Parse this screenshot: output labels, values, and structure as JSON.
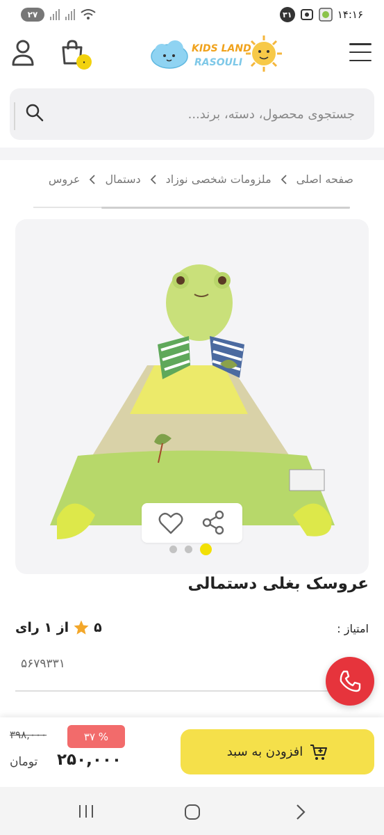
{
  "status_bar": {
    "time": "۱۴:۱۶",
    "notification_count": "۳۱",
    "battery": "۲۷"
  },
  "header": {
    "logo_line1": "KIDS LAND",
    "logo_line2": "RASOULI",
    "cart_count": "۰"
  },
  "search": {
    "placeholder": "جستجوی محصول، دسته، برند..."
  },
  "breadcrumb": [
    "صفحه اصلی",
    "ملزومات شخصی نوزاد",
    "دستمال",
    "عروس"
  ],
  "product": {
    "title": "عروسک بغلی دستمالی",
    "rating_label": "امتیاز :",
    "rating_score": "۵",
    "rating_suffix": "از ۱ رای",
    "sku": "۵۶۷۹۳۳۱"
  },
  "gallery": {
    "dots": 3,
    "active_dot": 0
  },
  "purchase": {
    "add_to_cart": "افزودن به سبد",
    "old_price": "۳۹۸,۰۰۰",
    "discount": "۳۷ %",
    "price": "۲۵۰,۰۰۰",
    "currency": "تومان"
  },
  "colors": {
    "accent_yellow": "#f5e04a",
    "call_red": "#e6343c",
    "discount_red": "#f26b6b"
  }
}
